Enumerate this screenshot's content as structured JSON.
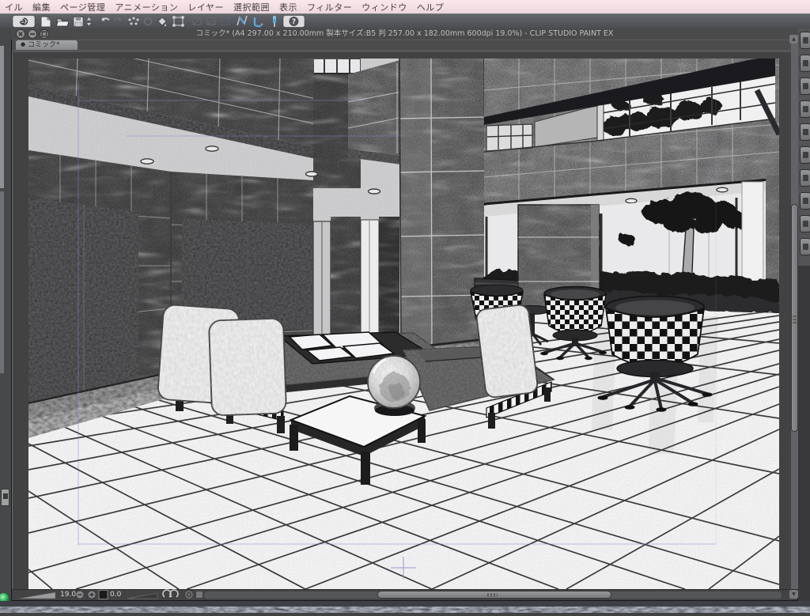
{
  "app": {
    "name": "CLIP STUDIO PAINT EX"
  },
  "menu_bar": {
    "items": [
      "イル",
      "編集",
      "ページ管理",
      "アニメーション",
      "レイヤー",
      "選択範囲",
      "表示",
      "フィルター",
      "ウィンドウ",
      "ヘルプ"
    ]
  },
  "toolbar": {
    "icons": [
      "clip-studio-logo",
      "new-document",
      "open-file",
      "save-file",
      "save-stepper",
      "undo",
      "redo",
      "object-dots",
      "snap-circle",
      "fill-tool",
      "transform-frame",
      "disabled-grid-1",
      "disabled-grid-2",
      "disabled-frame",
      "pen-tool-blue",
      "curve-tool-blue",
      "pin-tool-blue",
      "help"
    ]
  },
  "document_window": {
    "window_buttons": [
      "close",
      "minimize",
      "maximize"
    ],
    "title": "コミック* (A4 297.00 x 210.00mm 製本サイズ:B5 判 257.00 x 182.00mm 600dpi 19.0%)  - CLIP STUDIO PAINT EX",
    "tab": {
      "label": "コミック*",
      "modified": true
    },
    "status_bar": {
      "zoom_value": "19.0",
      "rotation_value": "0.0",
      "controls": [
        "zoom-slider",
        "zoom-out",
        "zoom-in",
        "fit-screen",
        "rotate-slider",
        "rotate-ccw",
        "rotate-cw",
        "reset-gear"
      ]
    }
  },
  "canvas": {
    "content": "monochrome comic line-art 3D preview of a hotel lobby interior",
    "elements": [
      "marble-beams",
      "white-ceiling",
      "recessed-lights",
      "marble-column",
      "elevator-door-panels",
      "glass-wall",
      "outdoor-tree",
      "stone-panel",
      "hedge",
      "tiled-floor",
      "white-sofas",
      "magazine-table",
      "coffee-table",
      "glass-sphere",
      "checkered-chairs",
      "side-table",
      "print-guides",
      "crosshair"
    ]
  },
  "side_docks": {
    "right_palette_buttons": 10
  },
  "colors": {
    "menu_bar_bg": "#f5dde2",
    "chrome_bg": "#4a4a4a",
    "canvas_bg": "#424242",
    "accent_blue": "#57a7e0"
  }
}
